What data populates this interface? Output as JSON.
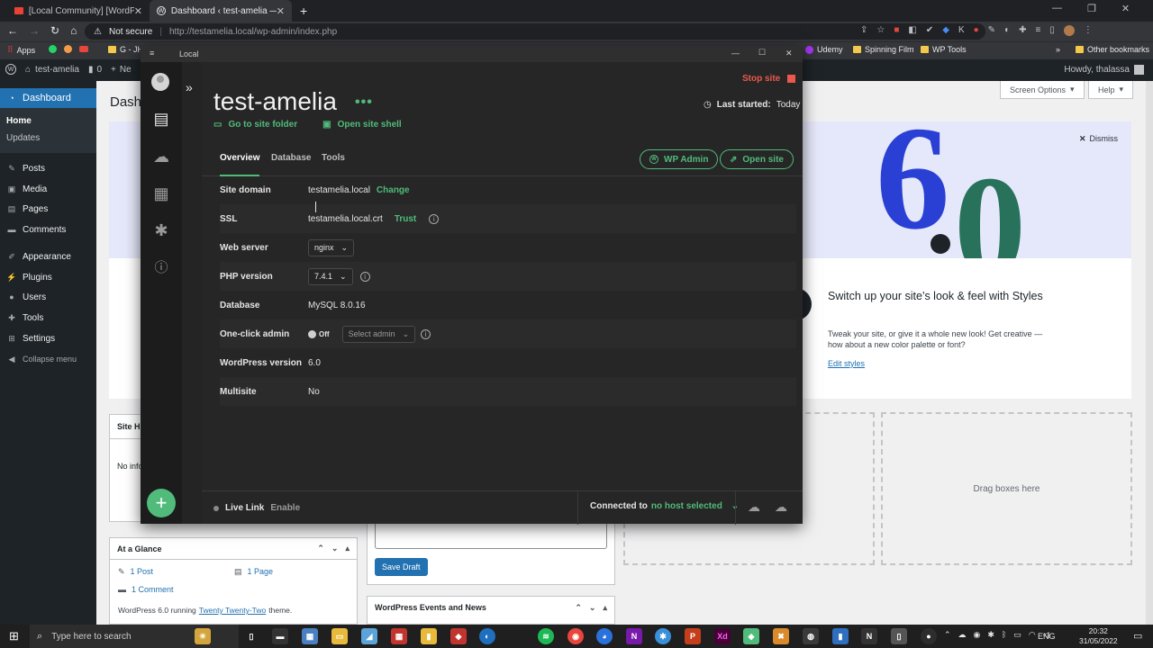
{
  "browser": {
    "tabs": [
      {
        "title": "[Local Community] [WordPress C"
      },
      {
        "title": "Dashboard ‹ test-amelia — Word"
      }
    ],
    "not_secure": "Not secure",
    "url": "http://testamelia.local/wp-admin/index.php",
    "bookmarks": [
      "Apps",
      "G - JH",
      "Udemy",
      "Spinning Film",
      "WP Tools",
      "Other bookmarks"
    ]
  },
  "adminbar": {
    "site": "test-amelia",
    "comments": "0",
    "new": "Ne",
    "howdy": "Howdy, thalassa"
  },
  "wp_sidebar": {
    "dashboard": "Dashboard",
    "home": "Home",
    "updates": "Updates",
    "items": [
      "Posts",
      "Media",
      "Pages",
      "Comments",
      "Appearance",
      "Plugins",
      "Users",
      "Tools",
      "Settings",
      "Collapse menu"
    ]
  },
  "wp_main": {
    "title_partial": "Dash",
    "screen_options": "Screen Options",
    "help": "Help",
    "dismiss": "Dismiss",
    "version_graphic": "6.0",
    "styles_heading": "Switch up your site’s look & feel with Styles",
    "styles_text": "Tweak your site, or give it a whole new look! Get creative — how about a new color palette or font?",
    "edit_styles": "Edit styles",
    "site_health_partial": "Site H",
    "no_info_partial": "No info",
    "drag_boxes": "Drag boxes here",
    "at_a_glance": "At a Glance",
    "glance_posts": "1 Post",
    "glance_pages": "1 Page",
    "glance_comments": "1 Comment",
    "running_prefix": "WordPress 6.0 running",
    "theme_link": "Twenty Twenty-Two",
    "running_suffix": "theme.",
    "save_draft": "Save Draft",
    "events_title": "WordPress Events and News"
  },
  "local_app": {
    "window_title": "Local",
    "stop_site": "Stop site",
    "site_name": "test-amelia",
    "last_started_label": "Last started:",
    "last_started_value": "Today",
    "go_to_folder": "Go to site folder",
    "open_shell": "Open site shell",
    "tabs": [
      "Overview",
      "Database",
      "Tools"
    ],
    "wp_admin": "WP Admin",
    "open_site": "Open site",
    "rows": {
      "domain": {
        "label": "Site domain",
        "value": "testamelia.local",
        "action": "Change"
      },
      "ssl": {
        "label": "SSL",
        "value": "testamelia.local.crt",
        "action": "Trust"
      },
      "web_server": {
        "label": "Web server",
        "value": "nginx"
      },
      "php": {
        "label": "PHP version",
        "value": "7.4.1"
      },
      "database": {
        "label": "Database",
        "value": "MySQL 8.0.16"
      },
      "one_click": {
        "label": "One-click admin",
        "toggle": "Off",
        "select": "Select admin"
      },
      "wp_version": {
        "label": "WordPress version",
        "value": "6.0"
      },
      "multisite": {
        "label": "Multisite",
        "value": "No"
      }
    },
    "live_link": "Live Link",
    "enable": "Enable",
    "connected_to": "Connected to",
    "no_host": "no host selected"
  },
  "taskbar": {
    "search_placeholder": "Type here to search",
    "lang": "ENG",
    "time": "20:32",
    "date": "31/05/2022"
  }
}
